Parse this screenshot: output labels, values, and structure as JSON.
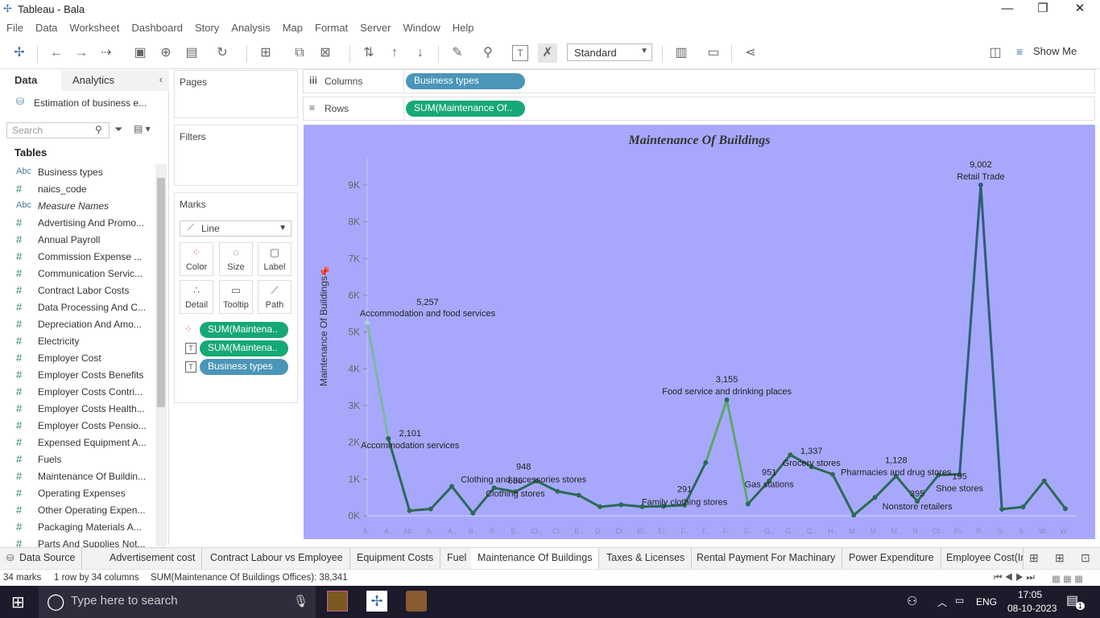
{
  "window": {
    "title": "Tableau - Bala",
    "min": "—",
    "restore": "❐",
    "close": "✕"
  },
  "menu": [
    "File",
    "Data",
    "Worksheet",
    "Dashboard",
    "Story",
    "Analysis",
    "Map",
    "Format",
    "Server",
    "Window",
    "Help"
  ],
  "toolbar": {
    "fit": "Standard",
    "show_me": "Show Me"
  },
  "data_pane": {
    "tab_data": "Data",
    "tab_analytics": "Analytics",
    "datasource": "Estimation of business e...",
    "search_placeholder": "Search",
    "tables_header": "Tables",
    "fields": [
      {
        "type": "Abc",
        "name": "Business types"
      },
      {
        "type": "#",
        "name": "naics_code"
      },
      {
        "type": "Abc",
        "name": "Measure Names"
      },
      {
        "type": "#",
        "name": "Advertising And Promo..."
      },
      {
        "type": "#",
        "name": "Annual Payroll"
      },
      {
        "type": "#",
        "name": "Commission Expense ..."
      },
      {
        "type": "#",
        "name": "Communication Servic..."
      },
      {
        "type": "#",
        "name": "Contract Labor Costs"
      },
      {
        "type": "#",
        "name": "Data Processing And C..."
      },
      {
        "type": "#",
        "name": "Depreciation And Amo..."
      },
      {
        "type": "#",
        "name": "Electricity"
      },
      {
        "type": "#",
        "name": "Employer Cost"
      },
      {
        "type": "#",
        "name": "Employer Costs Benefits"
      },
      {
        "type": "#",
        "name": "Employer Costs Contri..."
      },
      {
        "type": "#",
        "name": "Employer Costs Health..."
      },
      {
        "type": "#",
        "name": "Employer Costs Pensio..."
      },
      {
        "type": "#",
        "name": "Expensed Equipment A..."
      },
      {
        "type": "#",
        "name": "Fuels"
      },
      {
        "type": "#",
        "name": "Maintenance Of Buildin..."
      },
      {
        "type": "#",
        "name": "Operating Expenses"
      },
      {
        "type": "#",
        "name": "Other Operating Expen..."
      },
      {
        "type": "#",
        "name": "Packaging Materials A..."
      },
      {
        "type": "#",
        "name": "Parts And Supplies Not..."
      }
    ]
  },
  "cards": {
    "pages": "Pages",
    "filters": "Filters",
    "marks": "Marks",
    "mark_type": "Line",
    "mark_buttons": [
      "Color",
      "Size",
      "Label",
      "Detail",
      "Tooltip",
      "Path"
    ],
    "mark_pills": [
      "SUM(Maintena..",
      "SUM(Maintena..",
      "Business types"
    ]
  },
  "shelves": {
    "columns_label": "Columns",
    "columns_pill": "Business types",
    "rows_label": "Rows",
    "rows_pill": "SUM(Maintenance Of.."
  },
  "chart_data": {
    "type": "line",
    "title": "Maintenance Of Buildings",
    "ylabel": "Maintenance Of Buildings",
    "ylim": [
      0,
      10000
    ],
    "yticks": [
      "0K",
      "1K",
      "2K",
      "3K",
      "4K",
      "5K",
      "6K",
      "7K",
      "8K",
      "9K"
    ],
    "xtick_labels": [
      "A..",
      "A..",
      "Alt..",
      "A..",
      "A..",
      "B..",
      "B..",
      "B..",
      "Cl..",
      "Cl..",
      "B..",
      "D..",
      "Di..",
      "El..",
      "El..",
      "F..",
      "F..",
      "F..",
      "F..",
      "G..",
      "G..",
      "G..",
      "H..",
      "M..",
      "M..",
      "M..",
      "N..",
      "Ot..",
      "Pi..",
      "R..",
      "Si..",
      "S..",
      "W..",
      "W.."
    ],
    "values": [
      5257,
      2101,
      140,
      185,
      800,
      70,
      760,
      656,
      948,
      665,
      560,
      245,
      300,
      250,
      260,
      291,
      1450,
      3155,
      320,
      951,
      1660,
      1337,
      1128,
      20,
      500,
      1080,
      395,
      1110,
      1128,
      9002,
      180,
      240,
      950,
      195
    ],
    "annotations": [
      {
        "i": 0,
        "value": "5,257",
        "label": "Accommodation and food services"
      },
      {
        "i": 1,
        "value": "2,101",
        "label": "Accommodation services"
      },
      {
        "i": 7,
        "value": "656",
        "label": "Clothing stores"
      },
      {
        "i": 8,
        "value": "948",
        "label": "Clothing and accessories stores"
      },
      {
        "i": 15,
        "value": "291",
        "label": "Family clothing stores"
      },
      {
        "i": 17,
        "value": "3,155",
        "label": "Food service and drinking places"
      },
      {
        "i": 19,
        "value": "951",
        "label": "Gas stations"
      },
      {
        "i": 21,
        "value": "1,337",
        "label": "Grocery stores"
      },
      {
        "i": 25,
        "value": "1,128",
        "label": "Pharmacies and drug stores"
      },
      {
        "i": 26,
        "value": "395",
        "label": "Nonstore retailers"
      },
      {
        "i": 28,
        "value": "195",
        "label": "Shoe stores"
      },
      {
        "i": 29,
        "value": "9,002",
        "label": "Retail Trade"
      }
    ],
    "line_color": "#2b6a55",
    "background": "#a7a8fc"
  },
  "sheet_tabs": [
    "Data Source",
    "Advertisement cost",
    "Contract Labour vs Employee",
    "Equipment Costs",
    "Fuel",
    "Maintenance Of Buildings",
    "Taxes & Licenses",
    "Rental Payment For Machinary",
    "Power Expenditure",
    "Employee Cost(Ir"
  ],
  "active_tab": "Maintenance Of Buildings",
  "status": {
    "marks": "34 marks",
    "dims": "1 row by 34 columns",
    "sum": "SUM(Maintenance Of Buildings Offices): 38,341"
  },
  "taskbar": {
    "search_placeholder": "Type here to search",
    "lang": "ENG",
    "time": "17:05",
    "date": "08-10-2023",
    "notif": "1"
  }
}
